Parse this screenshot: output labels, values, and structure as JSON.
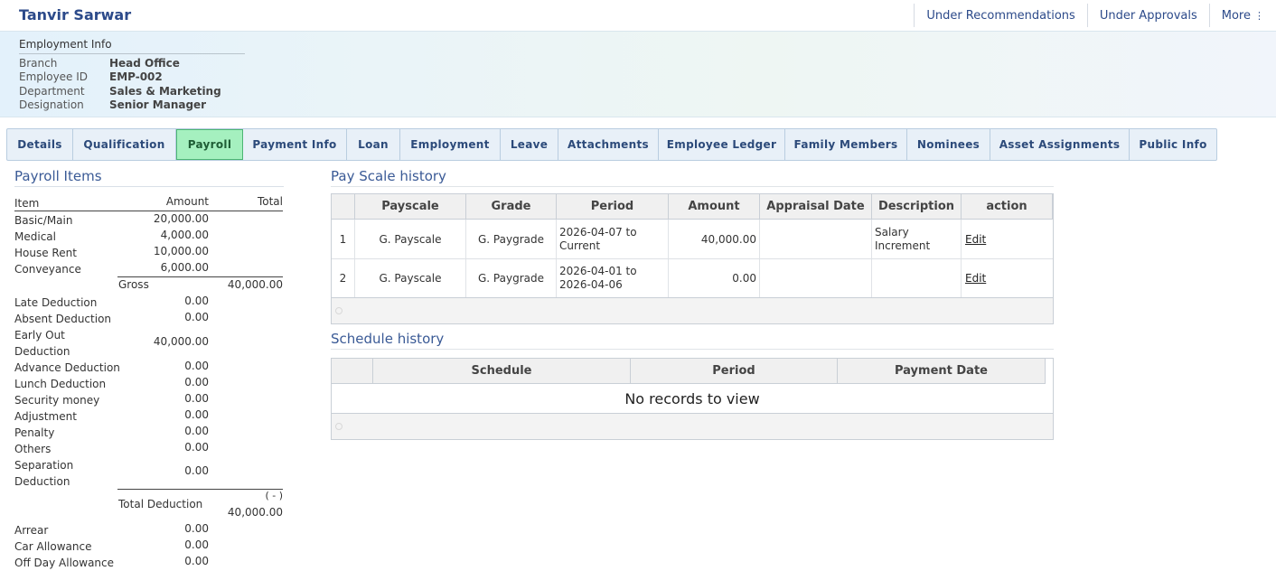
{
  "employee": {
    "name": "Tanvir Sarwar"
  },
  "top_actions": {
    "recommendations": "Under Recommendations",
    "approvals": "Under Approvals",
    "more": "More",
    "more_icon": "⋮"
  },
  "employment_info": {
    "title": "Employment Info",
    "fields": [
      {
        "label": "Branch",
        "value": "Head Office"
      },
      {
        "label": "Employee ID",
        "value": "EMP-002"
      },
      {
        "label": "Department",
        "value": "Sales & Marketing"
      },
      {
        "label": "Designation",
        "value": "Senior Manager"
      }
    ]
  },
  "tabs": [
    {
      "label": "Details"
    },
    {
      "label": "Qualification"
    },
    {
      "label": "Payroll",
      "active": true
    },
    {
      "label": "Payment Info"
    },
    {
      "label": "Loan"
    },
    {
      "label": "Employment"
    },
    {
      "label": "Leave"
    },
    {
      "label": "Attachments"
    },
    {
      "label": "Employee Ledger"
    },
    {
      "label": "Family Members"
    },
    {
      "label": "Nominees"
    },
    {
      "label": "Asset Assignments"
    },
    {
      "label": "Public Info"
    }
  ],
  "payroll_items": {
    "title": "Payroll Items",
    "headers": {
      "item": "Item",
      "amount": "Amount",
      "total": "Total"
    },
    "earnings": [
      {
        "item": "Basic/Main",
        "amount": "20,000.00"
      },
      {
        "item": "Medical",
        "amount": "4,000.00"
      },
      {
        "item": "House Rent",
        "amount": "10,000.00"
      },
      {
        "item": "Conveyance",
        "amount": "6,000.00"
      }
    ],
    "gross": {
      "label": "Gross",
      "total": "40,000.00"
    },
    "deductions": [
      {
        "item": "Late Deduction",
        "amount": "0.00"
      },
      {
        "item": "Absent Deduction",
        "amount": "0.00"
      },
      {
        "item": "Early Out Deduction",
        "amount": "40,000.00"
      },
      {
        "item": "Advance Deduction",
        "amount": "0.00"
      },
      {
        "item": "Lunch Deduction",
        "amount": "0.00"
      },
      {
        "item": "Security money",
        "amount": "0.00"
      },
      {
        "item": "Adjustment",
        "amount": "0.00"
      },
      {
        "item": "Penalty",
        "amount": "0.00"
      },
      {
        "item": "Others",
        "amount": "0.00"
      },
      {
        "item": "Separation Deduction",
        "amount": "0.00"
      }
    ],
    "total_deduction": {
      "label": "Total Deduction",
      "sign": "( - )",
      "total": "40,000.00"
    },
    "allowances": [
      {
        "item": "Arrear",
        "amount": "0.00"
      },
      {
        "item": "Car Allowance",
        "amount": "0.00"
      },
      {
        "item": "Off Day Allowance",
        "amount": "0.00"
      }
    ]
  },
  "pay_scale_history": {
    "title": "Pay Scale history",
    "columns": [
      "",
      "Payscale",
      "Grade",
      "Period",
      "Amount",
      "Appraisal Date",
      "Description",
      "action"
    ],
    "rows": [
      {
        "num": "1",
        "payscale": "G. Payscale",
        "grade": "G. Paygrade",
        "period": "2026-04-07 to Current",
        "amount": "40,000.00",
        "appraisal_date": "",
        "description": "Salary Increment",
        "action": "Edit"
      },
      {
        "num": "2",
        "payscale": "G. Payscale",
        "grade": "G. Paygrade",
        "period": "2026-04-01 to 2026-04-06",
        "amount": "0.00",
        "appraisal_date": "",
        "description": "",
        "action": "Edit"
      }
    ]
  },
  "schedule_history": {
    "title": "Schedule history",
    "columns": [
      "",
      "Schedule",
      "Period",
      "Payment Date"
    ],
    "empty_text": "No records to view"
  },
  "colors": {
    "accent_blue": "#2c4a8a",
    "active_tab_bg": "#a5f0bf",
    "active_tab_border": "#4cb574"
  }
}
